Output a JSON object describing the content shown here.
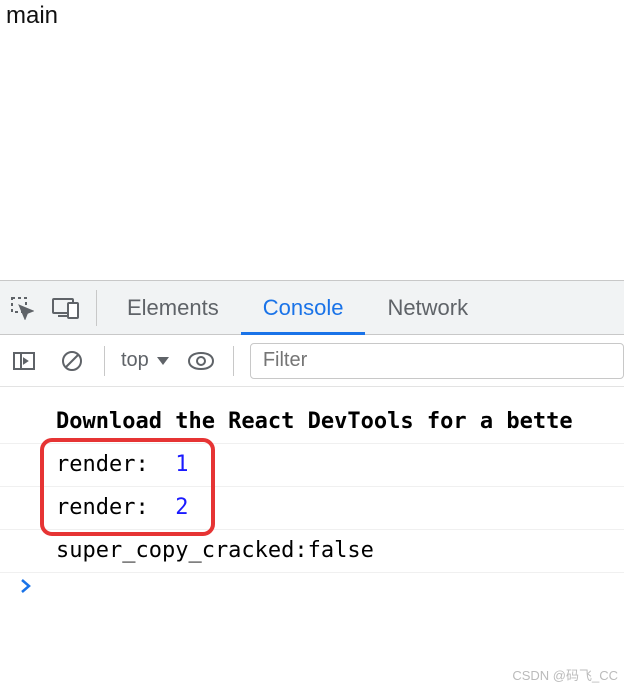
{
  "page": {
    "body_text": "main"
  },
  "tabs": {
    "elements": "Elements",
    "console": "Console",
    "network": "Network",
    "active": "console"
  },
  "toolbar": {
    "context": "top",
    "filter_placeholder": "Filter"
  },
  "console_lines": [
    {
      "kind": "bold",
      "text": "Download the React DevTools for a bette"
    },
    {
      "kind": "render",
      "label": "render: ",
      "value": "1"
    },
    {
      "kind": "render",
      "label": "render: ",
      "value": "2"
    },
    {
      "kind": "plain",
      "text": "super_copy_cracked:false"
    }
  ],
  "highlight": {
    "around_lines": [
      1,
      2
    ]
  },
  "watermark": "CSDN @码飞_CC"
}
